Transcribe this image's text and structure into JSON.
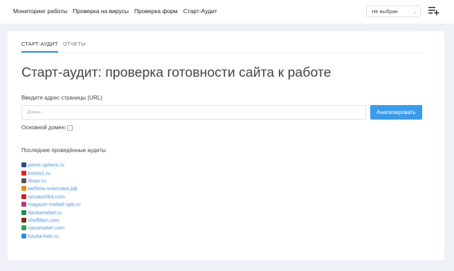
{
  "nav": {
    "items": [
      {
        "label": "Мониторинг работы"
      },
      {
        "label": "Проверка на вирусы"
      },
      {
        "label": "Проверка форм"
      },
      {
        "label": "Старт-Аудит"
      }
    ]
  },
  "project_select": {
    "value": "Не выбран"
  },
  "tabs": [
    {
      "label": "СТАРТ-АУДИТ",
      "active": true
    },
    {
      "label": "ОТЧЕТЫ",
      "active": false
    }
  ],
  "page_title": "Старт-аудит: проверка готовности сайта к работе",
  "url_form": {
    "label": "Введите адрес страницы (URL)",
    "placeholder": "Домен...",
    "value": "",
    "button_label": "Анализировать",
    "main_domain_label": "Основной домен:",
    "main_domain_checked": false
  },
  "recent": {
    "title": "Последние проведённые аудиты",
    "items": [
      {
        "domain": "prime-sphere.ru",
        "color": "#2b4a8a"
      },
      {
        "domain": "kresla1.ru",
        "color": "#d7261e"
      },
      {
        "domain": "divan.ru",
        "color": "#555555"
      },
      {
        "domain": "мебель-классика.рф",
        "color": "#e38a1c"
      },
      {
        "domain": "senator064.com",
        "color": "#c0272d"
      },
      {
        "domain": "magazin-mebeli-spb.ru",
        "color": "#b13a7a"
      },
      {
        "domain": "davitamebel.ru",
        "color": "#1b8f4d"
      },
      {
        "domain": "sheffilton.com",
        "color": "#7a2e1c"
      },
      {
        "domain": "nanomebel.com",
        "color": "#2aa05a"
      },
      {
        "domain": "futuka-kids.ru",
        "color": "#2f8dd6"
      }
    ]
  }
}
